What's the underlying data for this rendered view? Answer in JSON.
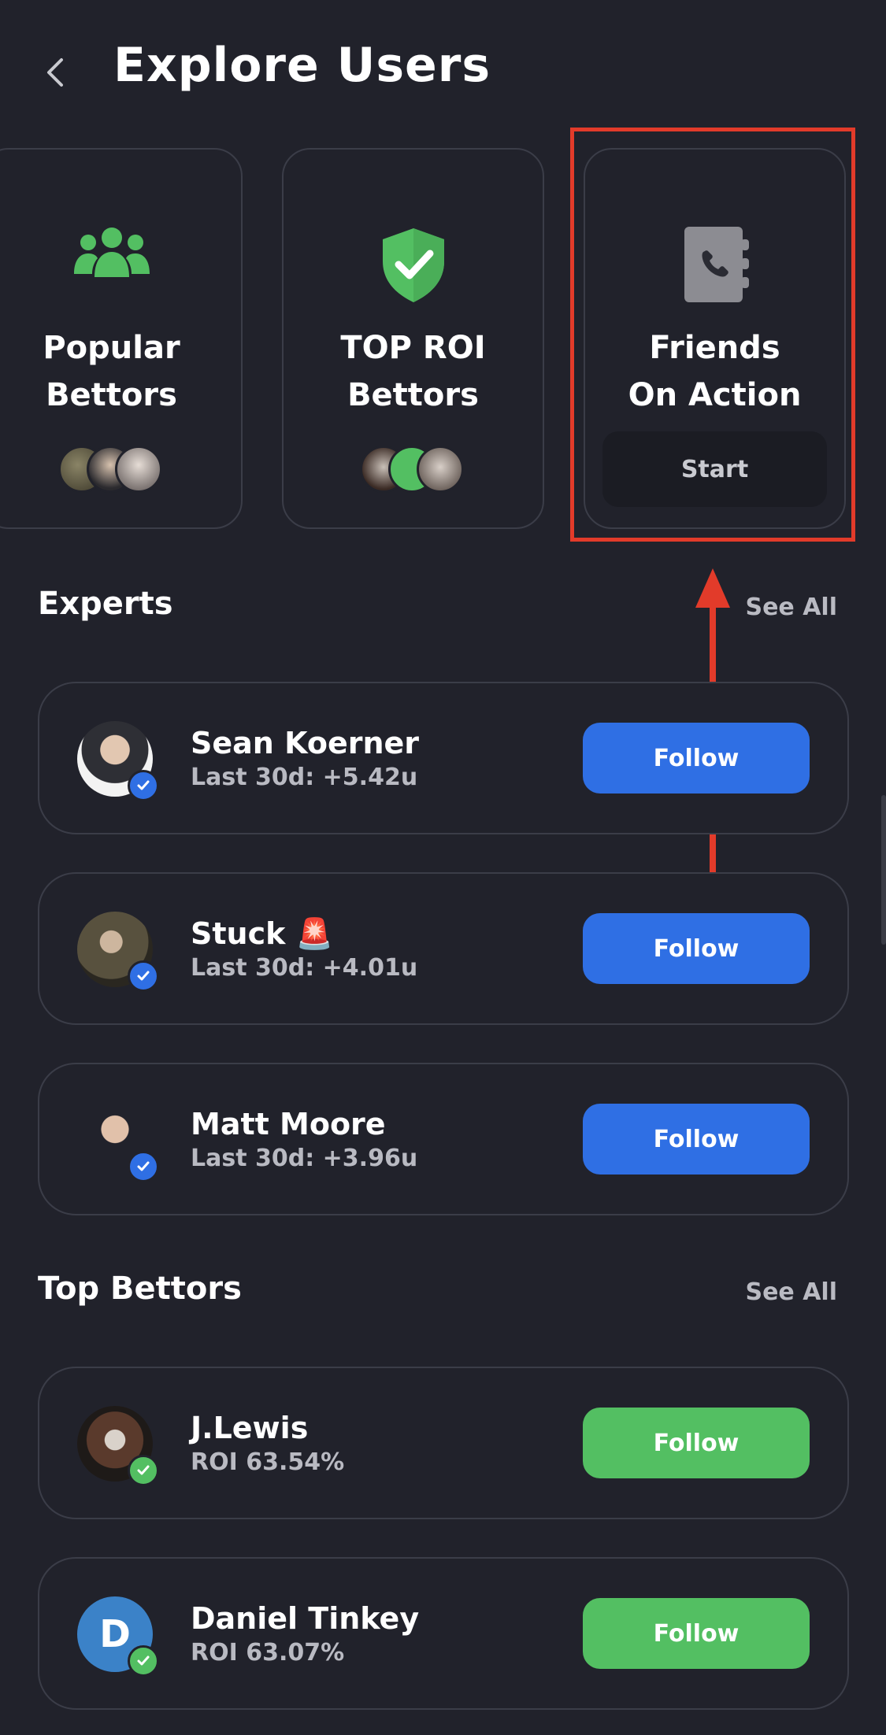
{
  "header": {
    "title": "Explore Users"
  },
  "categories": [
    {
      "title_line1": "Popular",
      "title_line2": "Bettors",
      "icon": "users-group-icon"
    },
    {
      "title_line1": "TOP ROI",
      "title_line2": "Bettors",
      "icon": "shield-check-icon"
    },
    {
      "title_line1": "Friends",
      "title_line2": "On Action",
      "icon": "phone-contacts-icon",
      "action_label": "Start"
    }
  ],
  "experts": {
    "title": "Experts",
    "see_all": "See All",
    "items": [
      {
        "name": "Sean Koerner",
        "stat": "Last 30d: +5.42u",
        "follow_label": "Follow"
      },
      {
        "name": "Stuck 🚨",
        "stat": "Last 30d: +4.01u",
        "follow_label": "Follow"
      },
      {
        "name": "Matt Moore",
        "stat": "Last 30d: +3.96u",
        "follow_label": "Follow"
      }
    ]
  },
  "top_bettors": {
    "title": "Top Bettors",
    "see_all": "See All",
    "items": [
      {
        "name": "J.Lewis",
        "stat": "ROI 63.54%",
        "follow_label": "Follow"
      },
      {
        "name": "Daniel Tinkey",
        "stat": "ROI 63.07%",
        "follow_label": "Follow",
        "initial": "D"
      }
    ]
  },
  "colors": {
    "background": "#21222b",
    "expert_follow": "#2f6fe4",
    "bettor_follow": "#53bf62",
    "highlight": "#e23b2a"
  }
}
